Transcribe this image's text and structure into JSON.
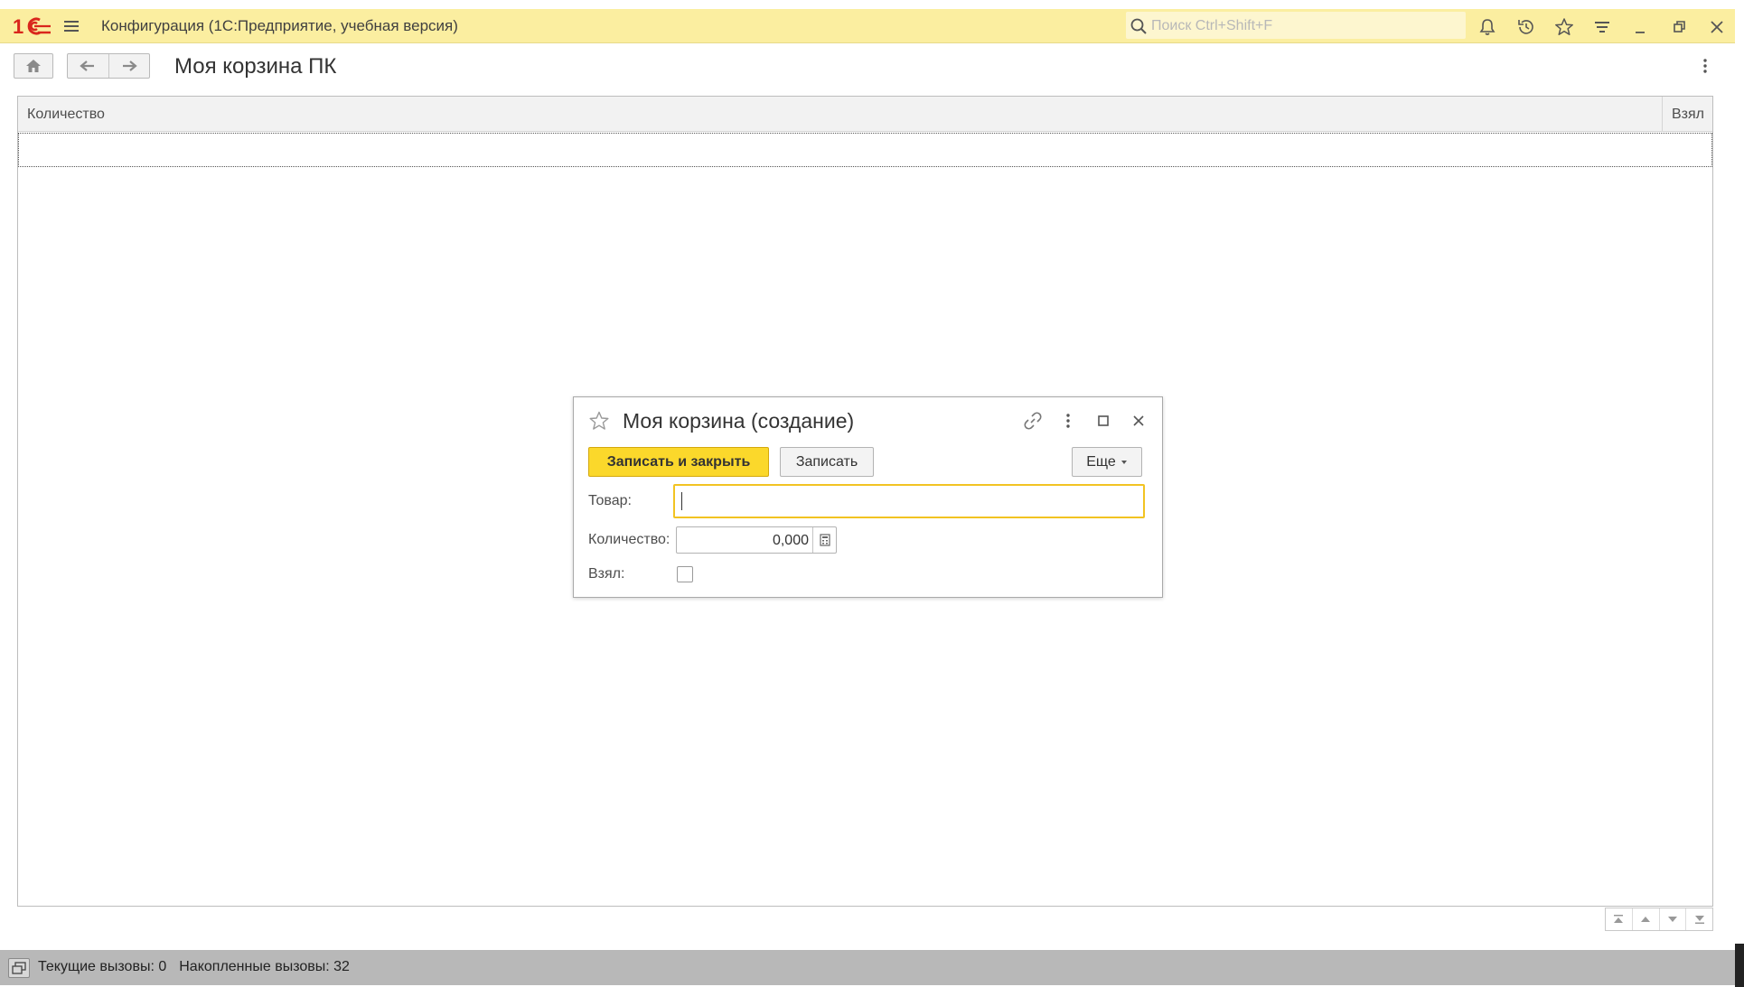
{
  "app": {
    "logo_text": "1С",
    "title": "Конфигурация  (1С:Предприятие, учебная версия)",
    "search_placeholder": "Поиск Ctrl+Shift+F",
    "icons": [
      "menu-icon",
      "search-icon",
      "bell-icon",
      "history-icon",
      "star-icon",
      "funnel-icon",
      "minimize-icon",
      "restore-icon",
      "close-icon"
    ],
    "accent_color": "#fbd82b",
    "title_bar_color": "#fbeea0"
  },
  "page": {
    "title": "Моя корзина ПК",
    "table": {
      "columns": [
        "Количество",
        "Взял"
      ],
      "rows": []
    }
  },
  "dialog": {
    "title": "Моя корзина (создание)",
    "buttons": {
      "save_close": "Записать и закрыть",
      "save": "Записать",
      "more": "Еще"
    },
    "fields": {
      "goods_label": "Товар:",
      "goods_value": "",
      "qty_label": "Количество:",
      "qty_value": "0,000",
      "took_label": "Взял:",
      "took_checked": false
    }
  },
  "status": {
    "current_calls": "Текущие вызовы: 0",
    "total_calls": "Накопленные вызовы: 32"
  }
}
